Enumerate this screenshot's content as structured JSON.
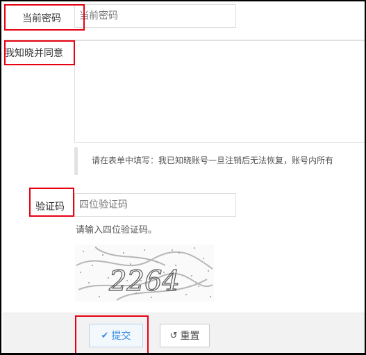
{
  "form": {
    "current_password": {
      "label": "当前密码",
      "placeholder": "当前密码"
    },
    "agree": {
      "label": "我知晓并同意",
      "notice": "请在表单中填写：我已知晓账号一旦注销后无法恢复，账号内所有"
    },
    "captcha": {
      "label": "验证码",
      "placeholder": "四位验证码",
      "help": "请输入四位验证码。",
      "image_text": "2264"
    }
  },
  "footer": {
    "submit_label": "提交",
    "submit_icon": "check-icon",
    "reset_label": "重置",
    "reset_icon": "undo-icon"
  },
  "highlight_color": "#e60012"
}
